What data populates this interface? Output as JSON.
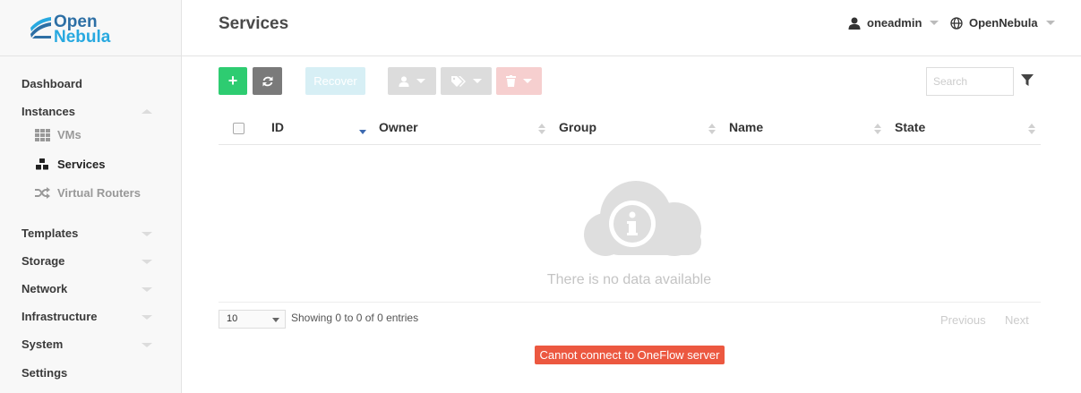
{
  "brand": {
    "line1": "Open",
    "line2": "Nebula"
  },
  "header": {
    "title": "Services",
    "user": "oneadmin",
    "zone": "OpenNebula"
  },
  "sidebar": {
    "dashboard": "Dashboard",
    "instances": "Instances",
    "vms": "VMs",
    "services": "Services",
    "virtual_routers": "Virtual Routers",
    "templates": "Templates",
    "storage": "Storage",
    "network": "Network",
    "infrastructure": "Infrastructure",
    "system": "System",
    "settings": "Settings"
  },
  "toolbar": {
    "create_label": "+",
    "recover_label": "Recover",
    "search_placeholder": "Search"
  },
  "table": {
    "columns": [
      "ID",
      "Owner",
      "Group",
      "Name",
      "State"
    ],
    "empty_message": "There is no data available",
    "page_length": "10",
    "info": "Showing 0 to 0 of 0 entries",
    "previous": "Previous",
    "next": "Next"
  },
  "alert": {
    "message": "Cannot connect to OneFlow server"
  },
  "colors": {
    "create": "#2ecc71",
    "refresh": "#7a7a7a",
    "alert": "#ec5840",
    "sort_active": "#3d6ab0"
  }
}
